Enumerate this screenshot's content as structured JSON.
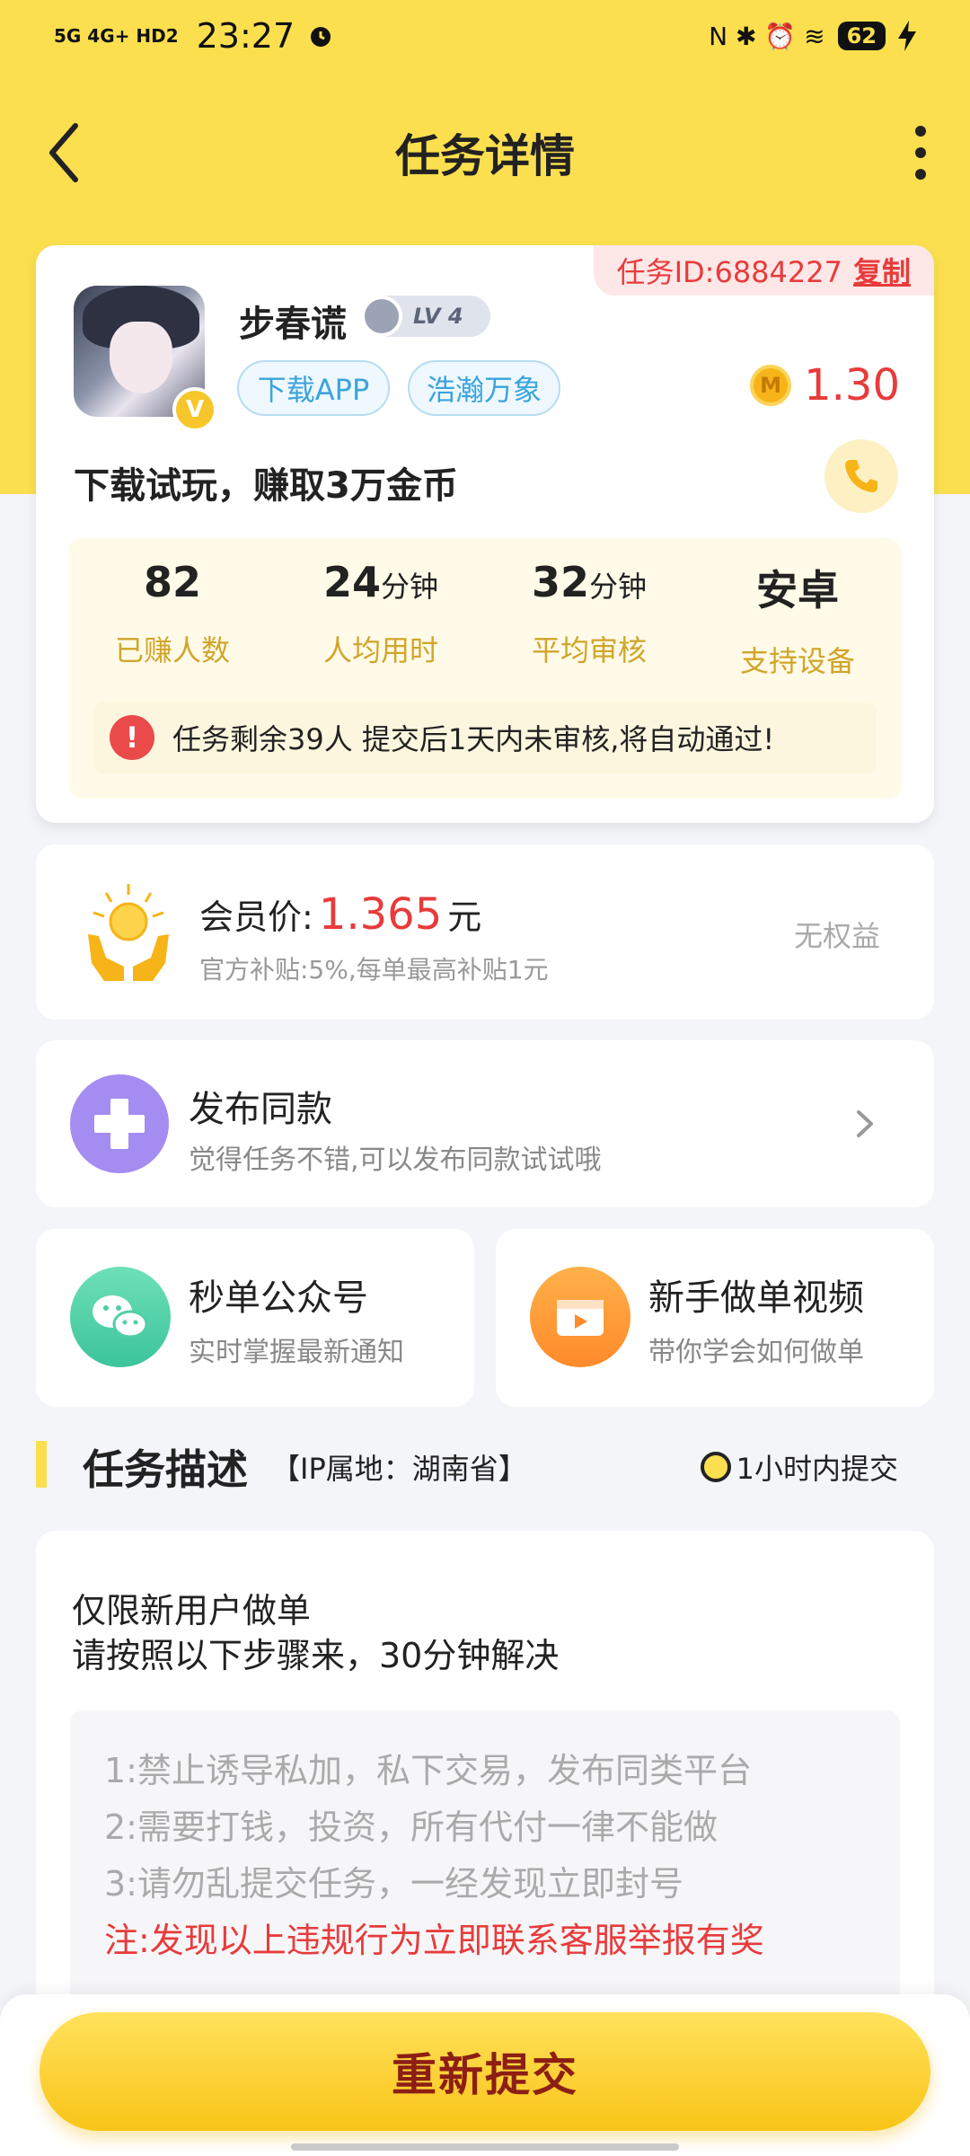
{
  "status_bar": {
    "network": "5G 4G+ HD2",
    "time": "23:27",
    "right_icons": "N ✱ ⏰ ≋",
    "battery": "62"
  },
  "navbar": {
    "title": "任务详情"
  },
  "task": {
    "id_label": "任务ID:6884227",
    "copy_label": "复制",
    "publisher_name": "步春谎",
    "level": "LV 4",
    "vip_badge": "V",
    "tags": [
      "下载APP",
      "浩瀚万象"
    ],
    "reward_coin_icon": "M",
    "reward": "1.30",
    "title": "下载试玩，赚取3万金币",
    "stats": [
      {
        "value": "82",
        "unit": "",
        "label": "已赚人数"
      },
      {
        "value": "24",
        "unit": "分钟",
        "label": "人均用时"
      },
      {
        "value": "32",
        "unit": "分钟",
        "label": "平均审核"
      },
      {
        "value": "安卓",
        "unit": "",
        "label": "支持设备"
      }
    ],
    "notice_icon": "!",
    "notice": "任务剩余39人  提交后1天内未审核,将自动通过!"
  },
  "member": {
    "label": "会员价:",
    "price": "1.365",
    "unit": "元",
    "subsidy": "官方补贴:5%,每单最高补贴1元",
    "status": "无权益"
  },
  "publish": {
    "title": "发布同款",
    "subtitle": "觉得任务不错,可以发布同款试试哦"
  },
  "shortcuts": [
    {
      "title": "秒单公众号",
      "subtitle": "实时掌握最新通知"
    },
    {
      "title": "新手做单视频",
      "subtitle": "带你学会如何做单"
    }
  ],
  "description": {
    "heading": "任务描述",
    "ip": "【IP属地：湖南省】",
    "deadline": "1小时内提交",
    "line1": "仅限新用户做单",
    "line2": "请按照以下步骤来，30分钟解决",
    "rules": [
      "1:禁止诱导私加，私下交易，发布同类平台",
      "2:需要打钱，投资，所有代付一律不能做",
      "3:请勿乱提交任务，一经发现立即封号"
    ],
    "warning": "注:发现以上违规行为立即联系客服举报有奖"
  },
  "submit_label": "重新提交",
  "colors": {
    "brand_yellow": "#fbdf4f",
    "accent_red": "#e83b3b",
    "stat_label": "#d1a52a"
  }
}
